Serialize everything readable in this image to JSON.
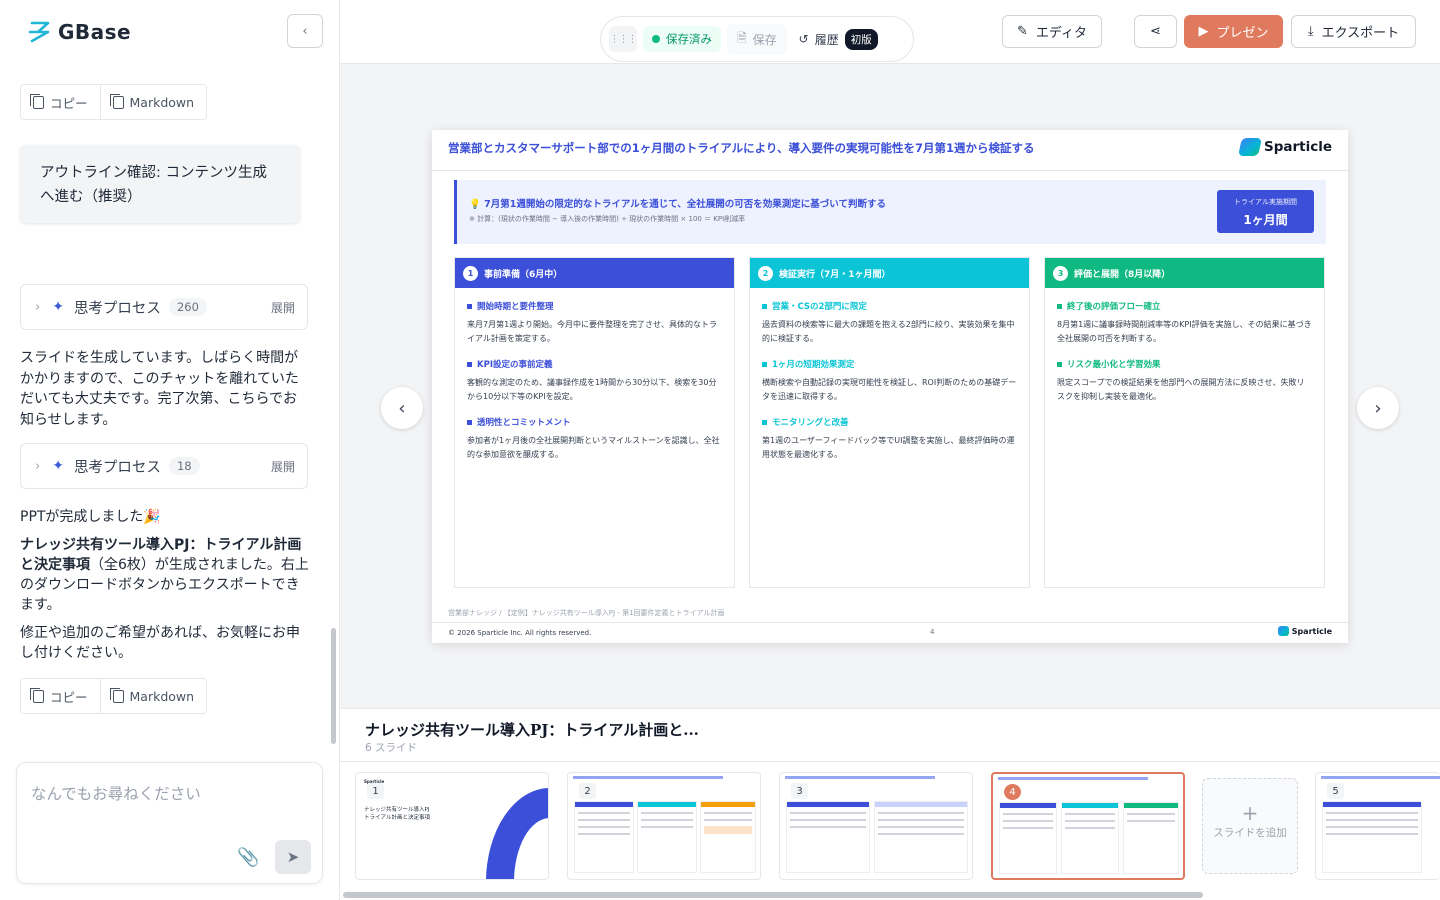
{
  "app": {
    "name": "GBase"
  },
  "sidebar": {
    "copy_label": "コピー",
    "markdown_label": "Markdown",
    "outline_card": "アウトライン確認: コンテンツ生成へ進む（推奨）",
    "think1": {
      "label": "思考プロセス",
      "count": "260",
      "expand": "展開"
    },
    "progress_msg": "スライドを生成しています。しばらく時間がかかりますので、このチャットを離れていただいても大丈夫です。完了次第、こちらでお知らせします。",
    "think2": {
      "label": "思考プロセス",
      "count": "18",
      "expand": "展開"
    },
    "done_line": "PPTが完成しました🎉",
    "done_bold": "ナレッジ共有ツール導入PJ：トライアル計画と決定事項",
    "done_rest": "（全6枚）が生成されました。右上のダウンロードボタンからエクスポートできます。",
    "followup": "修正や追加のご希望があれば、お気軽にお申し付けください。",
    "input_placeholder": "なんでもお尋ねください"
  },
  "toolbar": {
    "saved": "保存済み",
    "save": "保存",
    "history": "履歴",
    "version": "初版",
    "editor": "エディタ",
    "present": "プレゼン",
    "export": "エクスポート"
  },
  "slide": {
    "title": "営業部とカスタマーサポート部での1ヶ月間のトライアルにより、導入要件の実現可能性を7月第1週から検証する",
    "brand": "Sparticle",
    "banner_main": "💡 7月第1週開始の限定的なトライアルを通じて、全社展開の可否を効果測定に基づいて判断する",
    "banner_sub": "※ 計算：(現状の作業時間 − 導入後の作業時間) ÷ 現状の作業時間 × 100 ＝ KPI削減率",
    "pill_label": "トライアル実施期間",
    "pill_value": "1ヶ月間",
    "columns": [
      {
        "num": "1",
        "title": "事前準備（6月中）",
        "color": "#3b4fd8",
        "items": [
          {
            "h": "開始時期と要件整理",
            "t": "来月7月第1週より開始。今月中に要件整理を完了させ、具体的なトライアル計画を策定する。"
          },
          {
            "h": "KPI設定の事前定義",
            "t": "客観的な測定のため、議事録作成を1時間から30分以下、検索を30分から10分以下等のKPIを設定。"
          },
          {
            "h": "透明性とコミットメント",
            "t": "参加者が1ヶ月後の全社展開判断というマイルストーンを認識し、全社的な参加意欲を醸成する。"
          }
        ]
      },
      {
        "num": "2",
        "title": "検証実行（7月・1ヶ月間）",
        "color": "#0bc5d6",
        "items": [
          {
            "h": "営業・CSの2部門に限定",
            "t": "過去資料の検索等に最大の課題を抱える2部門に絞り、実装効果を集中的に検証する。"
          },
          {
            "h": "1ヶ月の短期効果測定",
            "t": "横断検索や自動記録の実現可能性を検証し、ROI判断のための基礎データを迅速に取得する。"
          },
          {
            "h": "モニタリングと改善",
            "t": "第1週のユーザーフィードバック等でUI調整を実施し、最終評価時の運用状態を最適化する。"
          }
        ]
      },
      {
        "num": "3",
        "title": "評価と展開（8月以降）",
        "color": "#10b981",
        "items": [
          {
            "h": "終了後の評価フロー確立",
            "t": "8月第1週に議事録時間削減率等のKPI評価を実施し、その結果に基づき全社展開の可否を判断する。"
          },
          {
            "h": "リスク最小化と学習効果",
            "t": "限定スコープでの検証結果を他部門への展開方法に反映させ、失敗リスクを抑制し実装を最適化。"
          }
        ]
      }
    ],
    "breadcrumb": "営業部ナレッジ /  【定例】ナレッジ共有ツール導入PJ - 第1回要件定義とトライアル計画",
    "copyright": "© 2026 Sparticle Inc. All rights reserved.",
    "page": "4"
  },
  "deck": {
    "title": "ナレッジ共有ツール導入PJ：トライアル計画と...",
    "count": "6 スライド",
    "thumb1_title": "ナレッジ共有ツール導入PJ\nトライアル計画と決定事項",
    "add_label": "スライドを追加",
    "nums": [
      "1",
      "2",
      "3",
      "4",
      "5"
    ]
  }
}
